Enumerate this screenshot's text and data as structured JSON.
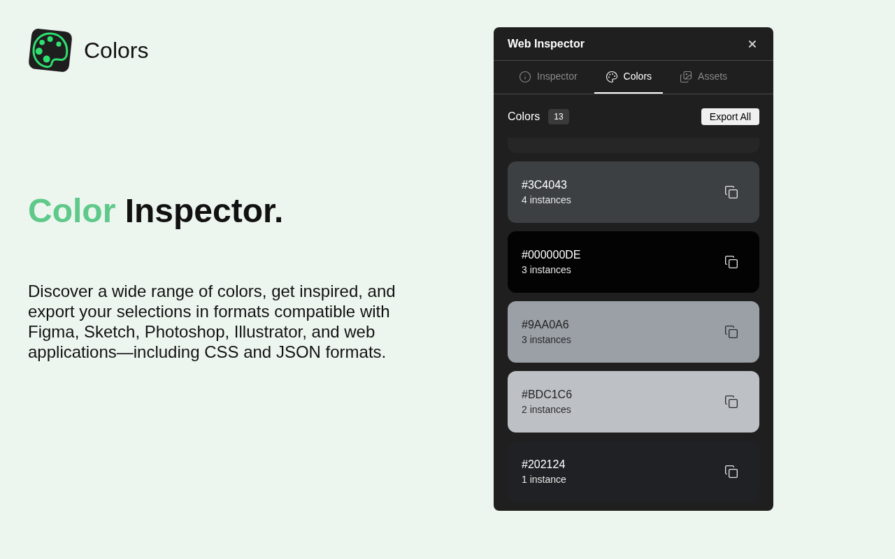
{
  "app": {
    "name": "Colors"
  },
  "hero": {
    "heading_accent": "Color",
    "heading_rest": "Inspector.",
    "description": "Discover a wide range of colors, get inspired, and export your selections in formats compatible with Figma, Sketch, Photoshop, Illustrator, and web applications—including CSS and JSON formats."
  },
  "panel": {
    "title": "Web Inspector",
    "tabs": [
      {
        "label": "Inspector",
        "selected": false
      },
      {
        "label": "Colors",
        "selected": true
      },
      {
        "label": "Assets",
        "selected": false
      }
    ],
    "section": {
      "title": "Colors",
      "count": "13",
      "export_button": "Export All"
    },
    "swatches": [
      {
        "kind": "clipped",
        "color": "#262626"
      },
      {
        "kind": "card",
        "hex": "#3C4043",
        "instances": "4 instances",
        "color": "#3c4043"
      },
      {
        "kind": "card",
        "hex": "#000000DE",
        "instances": "3 instances",
        "color": "#030303"
      },
      {
        "kind": "card",
        "hex": "#9AA0A6",
        "instances": "3 instances",
        "color": "#9aa0a6"
      },
      {
        "kind": "card",
        "hex": "#BDC1C6",
        "instances": "2 instances",
        "color": "#bdc1c6"
      },
      {
        "kind": "card",
        "hex": "#202124",
        "instances": "1 instance",
        "color": "#202124"
      }
    ]
  }
}
